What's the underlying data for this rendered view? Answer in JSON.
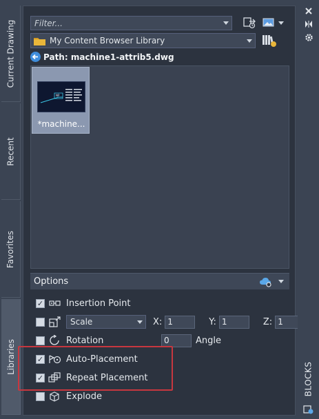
{
  "tabs": [
    {
      "label": "Current Drawing"
    },
    {
      "label": "Recent"
    },
    {
      "label": "Favorites"
    },
    {
      "label": "Libraries"
    }
  ],
  "filter": {
    "placeholder": "Filter..."
  },
  "library": {
    "selected": "My Content Browser Library"
  },
  "path": {
    "text": "Path: machine1-attrib5.dwg"
  },
  "thumbnail": {
    "label": "*machine..."
  },
  "options": {
    "header": "Options",
    "insertion_point": {
      "label": "Insertion Point",
      "checked": true
    },
    "scale": {
      "mode": "Scale",
      "x_label": "X:",
      "x_value": "1",
      "y_label": "Y:",
      "y_value": "1",
      "z_label": "Z:",
      "z_value": "1",
      "checked": false
    },
    "rotation": {
      "label": "Rotation",
      "angle_value": "0",
      "angle_label": "Angle",
      "checked": false
    },
    "auto_placement": {
      "label": "Auto-Placement",
      "checked": true
    },
    "repeat_placement": {
      "label": "Repeat Placement",
      "checked": true
    },
    "explode": {
      "label": "Explode",
      "checked": false
    }
  },
  "side_panel": {
    "title": "BLOCKS"
  },
  "colors": {
    "highlight": "#c8373f",
    "accent": "#3f8ddc",
    "panel": "#2c333f"
  }
}
